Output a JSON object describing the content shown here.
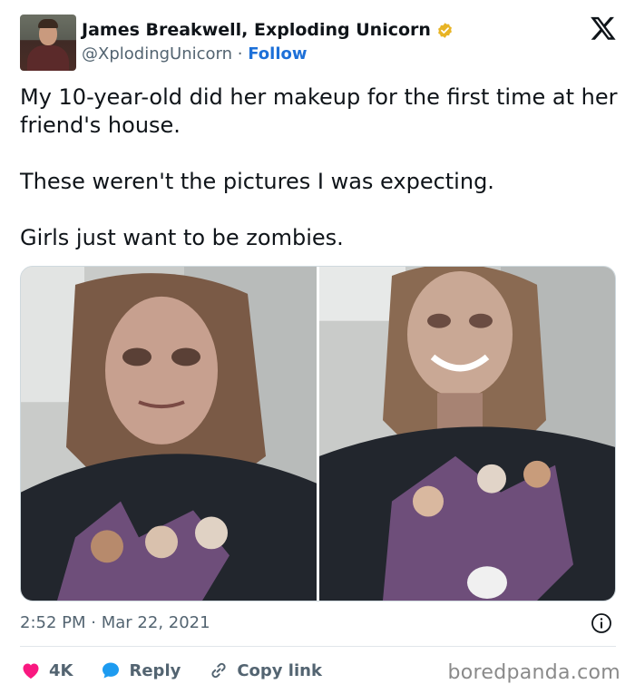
{
  "author": {
    "name": "James Breakwell, Exploding Unicorn",
    "handle": "@XplodingUnicorn",
    "separator": "·",
    "follow_label": "Follow"
  },
  "icons": {
    "avatar": "avatar-photo",
    "verified": "verified-badge-icon",
    "brand": "x-logo-icon",
    "info": "info-icon",
    "like": "heart-icon",
    "reply": "reply-bubble-icon",
    "copy": "link-icon"
  },
  "colors": {
    "verified_badge": "#e8b425",
    "follow": "#1d70d8",
    "like": "#f91880",
    "reply": "#1d9bf0"
  },
  "tweet": {
    "paragraphs": [
      "My 10-year-old did her makeup for the first time at her friend's house.",
      "These weren't the pictures I was expecting.",
      "Girls just want to be zombies."
    ],
    "time": "2:52 PM",
    "date_separator": "·",
    "date": "Mar 22, 2021"
  },
  "media": {
    "count": 2
  },
  "actions": {
    "like_count": "4K",
    "reply_label": "Reply",
    "copy_label": "Copy link"
  },
  "watermark": "boredpanda.com"
}
